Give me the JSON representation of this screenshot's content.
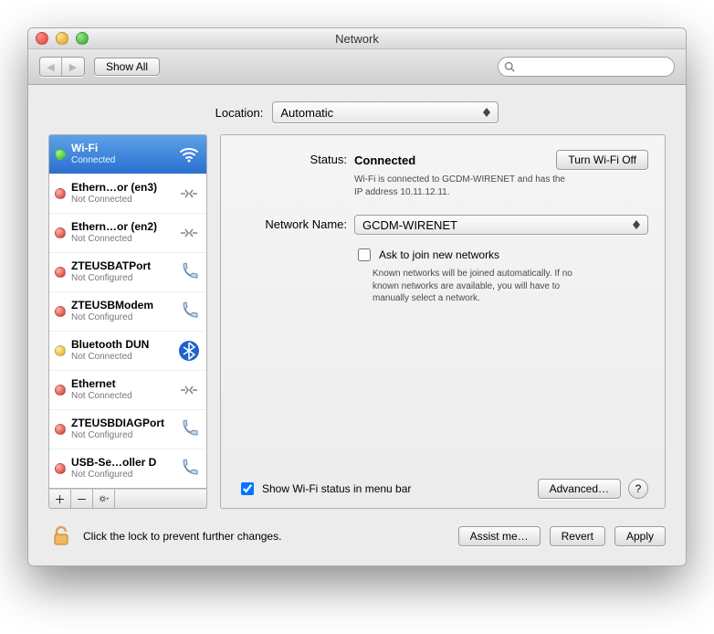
{
  "window": {
    "title": "Network"
  },
  "toolbar": {
    "show_all": "Show All",
    "search_placeholder": ""
  },
  "location": {
    "label": "Location:",
    "value": "Automatic"
  },
  "services": [
    {
      "name": "Wi-Fi",
      "status": "Connected",
      "dot": "green",
      "icon": "wifi",
      "selected": true
    },
    {
      "name": "Ethern…or (en3)",
      "status": "Not Connected",
      "dot": "red",
      "icon": "ethernet"
    },
    {
      "name": "Ethern…or (en2)",
      "status": "Not Connected",
      "dot": "red",
      "icon": "ethernet"
    },
    {
      "name": "ZTEUSBATPort",
      "status": "Not Configured",
      "dot": "red",
      "icon": "phone"
    },
    {
      "name": "ZTEUSBModem",
      "status": "Not Configured",
      "dot": "red",
      "icon": "phone"
    },
    {
      "name": "Bluetooth DUN",
      "status": "Not Connected",
      "dot": "yellow",
      "icon": "bluetooth"
    },
    {
      "name": "Ethernet",
      "status": "Not Connected",
      "dot": "red",
      "icon": "ethernet"
    },
    {
      "name": "ZTEUSBDIAGPort",
      "status": "Not Configured",
      "dot": "red",
      "icon": "phone"
    },
    {
      "name": "USB-Se…oller D",
      "status": "Not Configured",
      "dot": "red",
      "icon": "phone"
    }
  ],
  "detail": {
    "status_label": "Status:",
    "status_value": "Connected",
    "toggle_button": "Turn Wi-Fi Off",
    "status_desc": "Wi-Fi is connected to GCDM-WIRENET and has the IP address 10.11.12.11.",
    "network_label": "Network Name:",
    "network_value": "GCDM-WIRENET",
    "ask_join_label": "Ask to join new networks",
    "ask_join_desc": "Known networks will be joined automatically. If no known networks are available, you will have to manually select a network.",
    "show_status_label": "Show Wi-Fi status in menu bar",
    "advanced_button": "Advanced…"
  },
  "bottom": {
    "lock_text": "Click the lock to prevent further changes.",
    "assist": "Assist me…",
    "revert": "Revert",
    "apply": "Apply"
  }
}
